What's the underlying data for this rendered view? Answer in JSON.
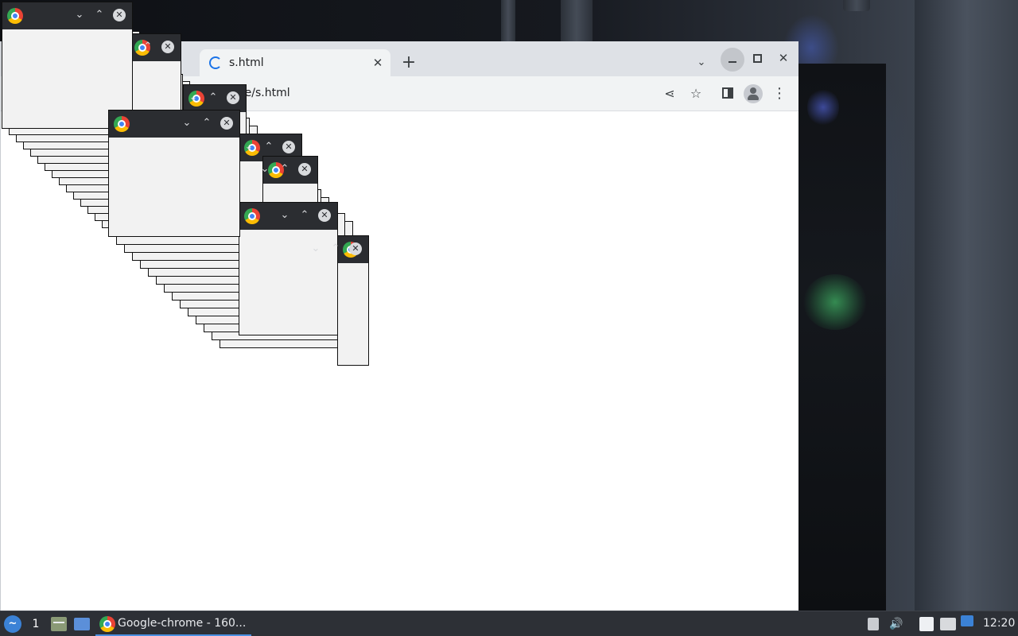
{
  "browser": {
    "tab_title": "s.html",
    "url_fragment": "obrane/s.html",
    "tab_close_glyph": "✕",
    "new_tab_glyph": "+",
    "tab_search_glyph": "⌄",
    "close_window_glyph": "✕",
    "kebab_glyph": "⋮",
    "share_glyph": "⋖",
    "star_glyph": "☆"
  },
  "popup_window": {
    "controls_down": "⌄",
    "controls_up": "⌃",
    "close": "✕"
  },
  "taskbar": {
    "workspace_number": "1",
    "task_label": "Google-chrome - 160...",
    "clock": "12:20",
    "start_glyph": "~",
    "volume_glyph": "🔊"
  },
  "icons": [
    "chrome-icon",
    "tab-loading-icon",
    "close-icon",
    "plus-icon",
    "chevron-down-icon",
    "minimize-icon",
    "maximize-icon",
    "share-icon",
    "star-icon",
    "side-panel-icon",
    "profile-icon",
    "more-menu-icon",
    "start-menu-icon",
    "file-manager-icon",
    "show-desktop-icon",
    "volume-icon",
    "network-icon",
    "notification-icon"
  ]
}
